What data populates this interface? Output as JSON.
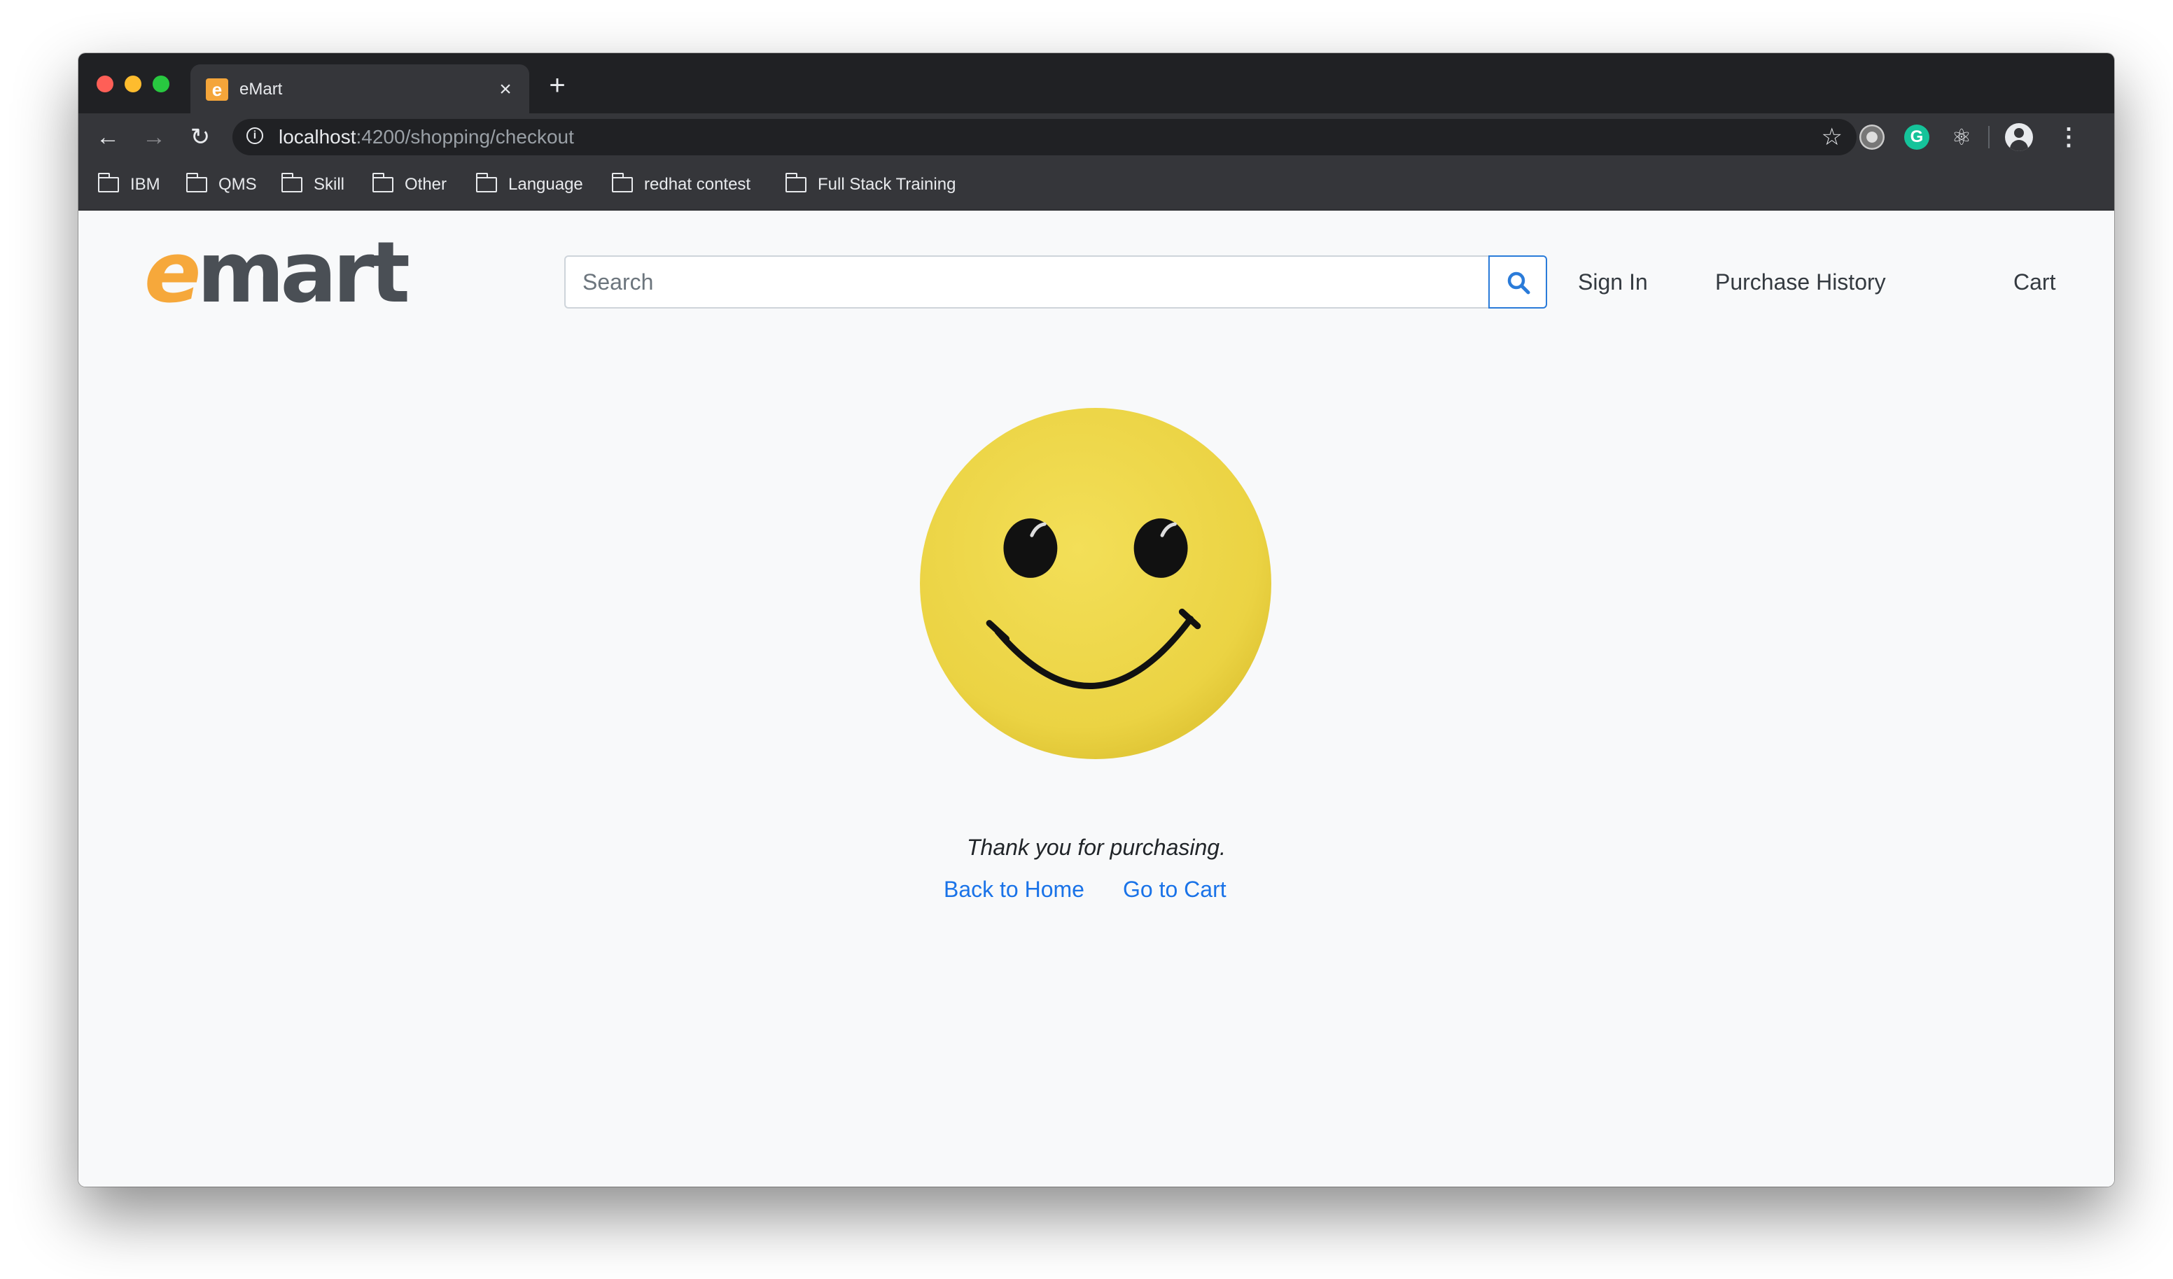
{
  "browser": {
    "tab": {
      "title": "eMart",
      "favicon_letter": "e",
      "close_glyph": "×"
    },
    "new_tab_glyph": "+",
    "url": {
      "host": "localhost",
      "path": ":4200/shopping/checkout"
    },
    "bookmarks": [
      {
        "label": "IBM"
      },
      {
        "label": "QMS"
      },
      {
        "label": "Skill"
      },
      {
        "label": "Other"
      },
      {
        "label": "Language"
      },
      {
        "label": "redhat contest"
      },
      {
        "label": "Full Stack Training"
      }
    ],
    "extensions": {
      "grammarly_letter": "G"
    }
  },
  "header": {
    "logo": {
      "first": "e",
      "rest": "mart"
    },
    "search": {
      "placeholder": "Search",
      "value": ""
    },
    "nav": {
      "sign_in": "Sign In",
      "purchase_history": "Purchase History",
      "cart": "Cart"
    }
  },
  "main": {
    "message": "Thank you for purchasing.",
    "back_to_home": "Back to Home",
    "go_to_cart": "Go to Cart"
  },
  "colors": {
    "accent": "#1a73e8",
    "logo_orange": "#f6a83b",
    "logo_gray": "#4a4f55",
    "smiley_yellow": "#efd84a"
  }
}
